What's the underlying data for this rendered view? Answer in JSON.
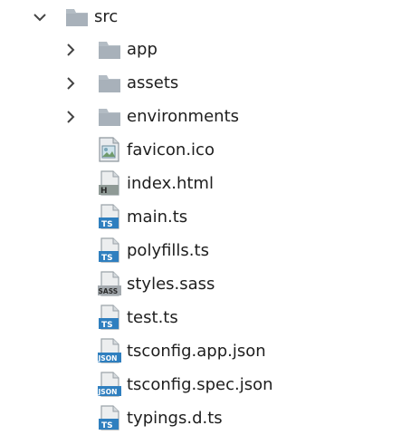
{
  "explorer": {
    "root": {
      "label": "src",
      "expanded": true,
      "icon": "folder-icon"
    },
    "folders": [
      {
        "label": "app",
        "expanded": false,
        "icon": "folder-icon"
      },
      {
        "label": "assets",
        "expanded": false,
        "icon": "folder-icon"
      },
      {
        "label": "environments",
        "expanded": false,
        "icon": "folder-icon"
      }
    ],
    "files": [
      {
        "label": "favicon.ico",
        "icon": "image-file-icon",
        "badge": ""
      },
      {
        "label": "index.html",
        "icon": "html-file-icon",
        "badge": "H"
      },
      {
        "label": "main.ts",
        "icon": "typescript-file-icon",
        "badge": "TS"
      },
      {
        "label": "polyfills.ts",
        "icon": "typescript-file-icon",
        "badge": "TS"
      },
      {
        "label": "styles.sass",
        "icon": "sass-file-icon",
        "badge": "SASS"
      },
      {
        "label": "test.ts",
        "icon": "typescript-file-icon",
        "badge": "TS"
      },
      {
        "label": "tsconfig.app.json",
        "icon": "json-file-icon",
        "badge": "JSON"
      },
      {
        "label": "tsconfig.spec.json",
        "icon": "json-file-icon",
        "badge": "JSON"
      },
      {
        "label": "typings.d.ts",
        "icon": "typescript-file-icon",
        "badge": "TS"
      }
    ]
  },
  "colors": {
    "folder": "#b3bcc4",
    "folder_dark": "#9aa5ae",
    "ts_badge": "#2f7fbf",
    "json_badge": "#2f7fbf",
    "sass_badge": "#9aa0a6",
    "html_badge": "#8f9a96",
    "chevron": "#444444",
    "text": "#1e1e1e"
  }
}
